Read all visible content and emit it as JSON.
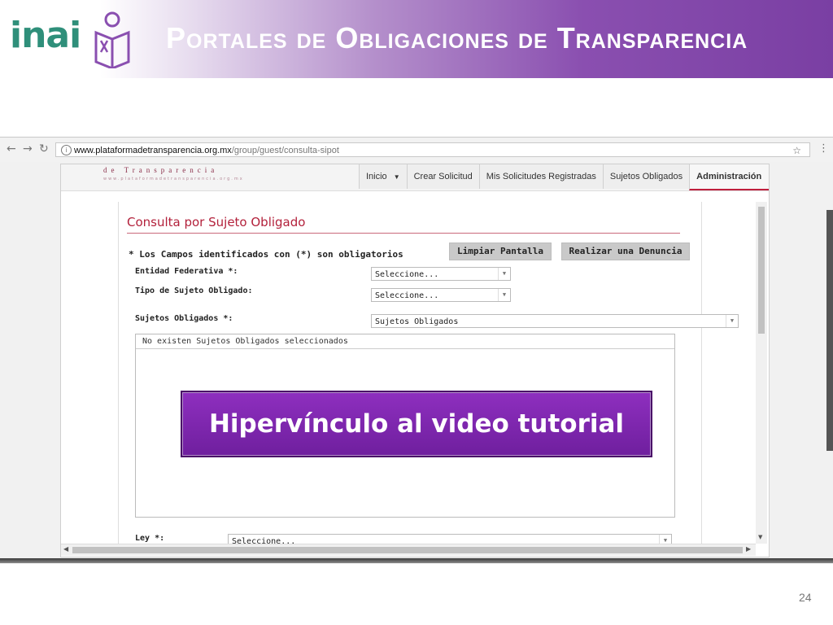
{
  "slide": {
    "title": "Portales de Obligaciones de Transparencia",
    "logo_text": "inai",
    "number": "24",
    "colors": {
      "primary_purple": "#7a3fa3",
      "logo_green": "#2f8f7a",
      "accent_red": "#b3213b"
    }
  },
  "browser": {
    "url_host": "www.plataformadetransparencia.org.mx",
    "url_path": "/group/guest/consulta-sipot",
    "icons": [
      "back-icon",
      "forward-icon",
      "reload-icon",
      "info-icon",
      "star-icon",
      "menu-icon"
    ]
  },
  "site": {
    "brand_sub": "de Transparencia",
    "brand_url": "www.plataformadetransparencia.org.mx",
    "nav": [
      {
        "label": "Inicio"
      },
      {
        "label": "Crear Solicitud"
      },
      {
        "label": "Mis Solicitudes Registradas"
      },
      {
        "label": "Sujetos Obligados"
      },
      {
        "label": "Administración"
      }
    ]
  },
  "form": {
    "title": "Consulta por Sujeto Obligado",
    "required_note": "* Los Campos identificados con (*) son obligatorios",
    "clear_button": "Limpiar Pantalla",
    "report_button": "Realizar una Denuncia",
    "entidad_label": "Entidad Federativa *:",
    "entidad_value": "Seleccione...",
    "tipo_label": "Tipo de Sujeto Obligado:",
    "tipo_value": "Seleccione...",
    "sujetos_label": "Sujetos Obligados *:",
    "sujetos_value": "Sujetos Obligados",
    "list_header": "No existen Sujetos Obligados seleccionados",
    "ley_label": "Ley *:",
    "ley_value": "Seleccione..."
  },
  "overlay": {
    "video_link": "Hipervínculo al video tutorial"
  }
}
